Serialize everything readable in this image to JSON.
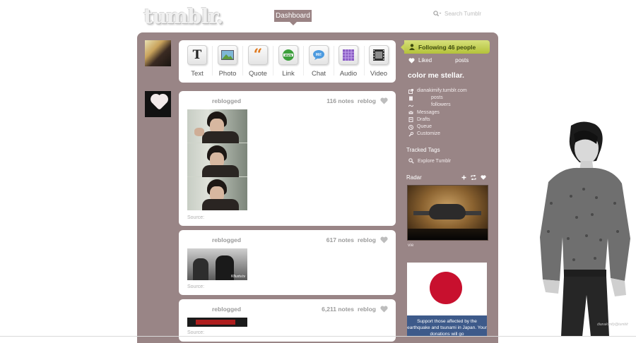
{
  "header": {
    "logo": "tumblr.",
    "dashboard_tab": "Dashboard",
    "search_placeholder": "Search Tumblr"
  },
  "post_types": [
    {
      "label": "Text",
      "icon": "text-icon"
    },
    {
      "label": "Photo",
      "icon": "photo-icon"
    },
    {
      "label": "Quote",
      "icon": "quote-icon"
    },
    {
      "label": "Link",
      "icon": "link-icon"
    },
    {
      "label": "Chat",
      "icon": "chat-icon"
    },
    {
      "label": "Audio",
      "icon": "audio-icon"
    },
    {
      "label": "Video",
      "icon": "video-icon"
    }
  ],
  "posts": [
    {
      "reblogged": "reblogged",
      "notes": "116 notes",
      "reblog": "reblog",
      "source": "Source:"
    },
    {
      "reblogged": "reblogged",
      "notes": "617 notes",
      "reblog": "reblog",
      "source": "Source:",
      "image_mark": "Kfluxtv.tv"
    },
    {
      "reblogged": "reblogged",
      "notes": "6,211 notes",
      "reblog": "reblog",
      "source": "Source:"
    }
  ],
  "sidebar": {
    "following": "Following 46 people",
    "liked": "Liked",
    "liked_posts": "posts",
    "blog_title": "color me stellar.",
    "blog_url": "dianakimify.tumblr.com",
    "posts": "posts",
    "followers": "followers",
    "messages": "Messages",
    "drafts": "Drafts",
    "queue": "Queue",
    "customize": "Customize",
    "tracked_tags": "Tracked Tags",
    "explore": "Explore Tumblr",
    "radar": "Radar",
    "radar_caption": "vie",
    "ad_text": "Support those affected by the earthquake and tsunami in Japan. Your donations will go"
  },
  "watermark": "dianakimify@tumblr",
  "colors": {
    "panel": "#998586",
    "dashboard_tab": "#9a8384",
    "following_badge": "#c7d35a",
    "japan_red": "#c8102e",
    "ad_band": "#3d5a8a"
  }
}
